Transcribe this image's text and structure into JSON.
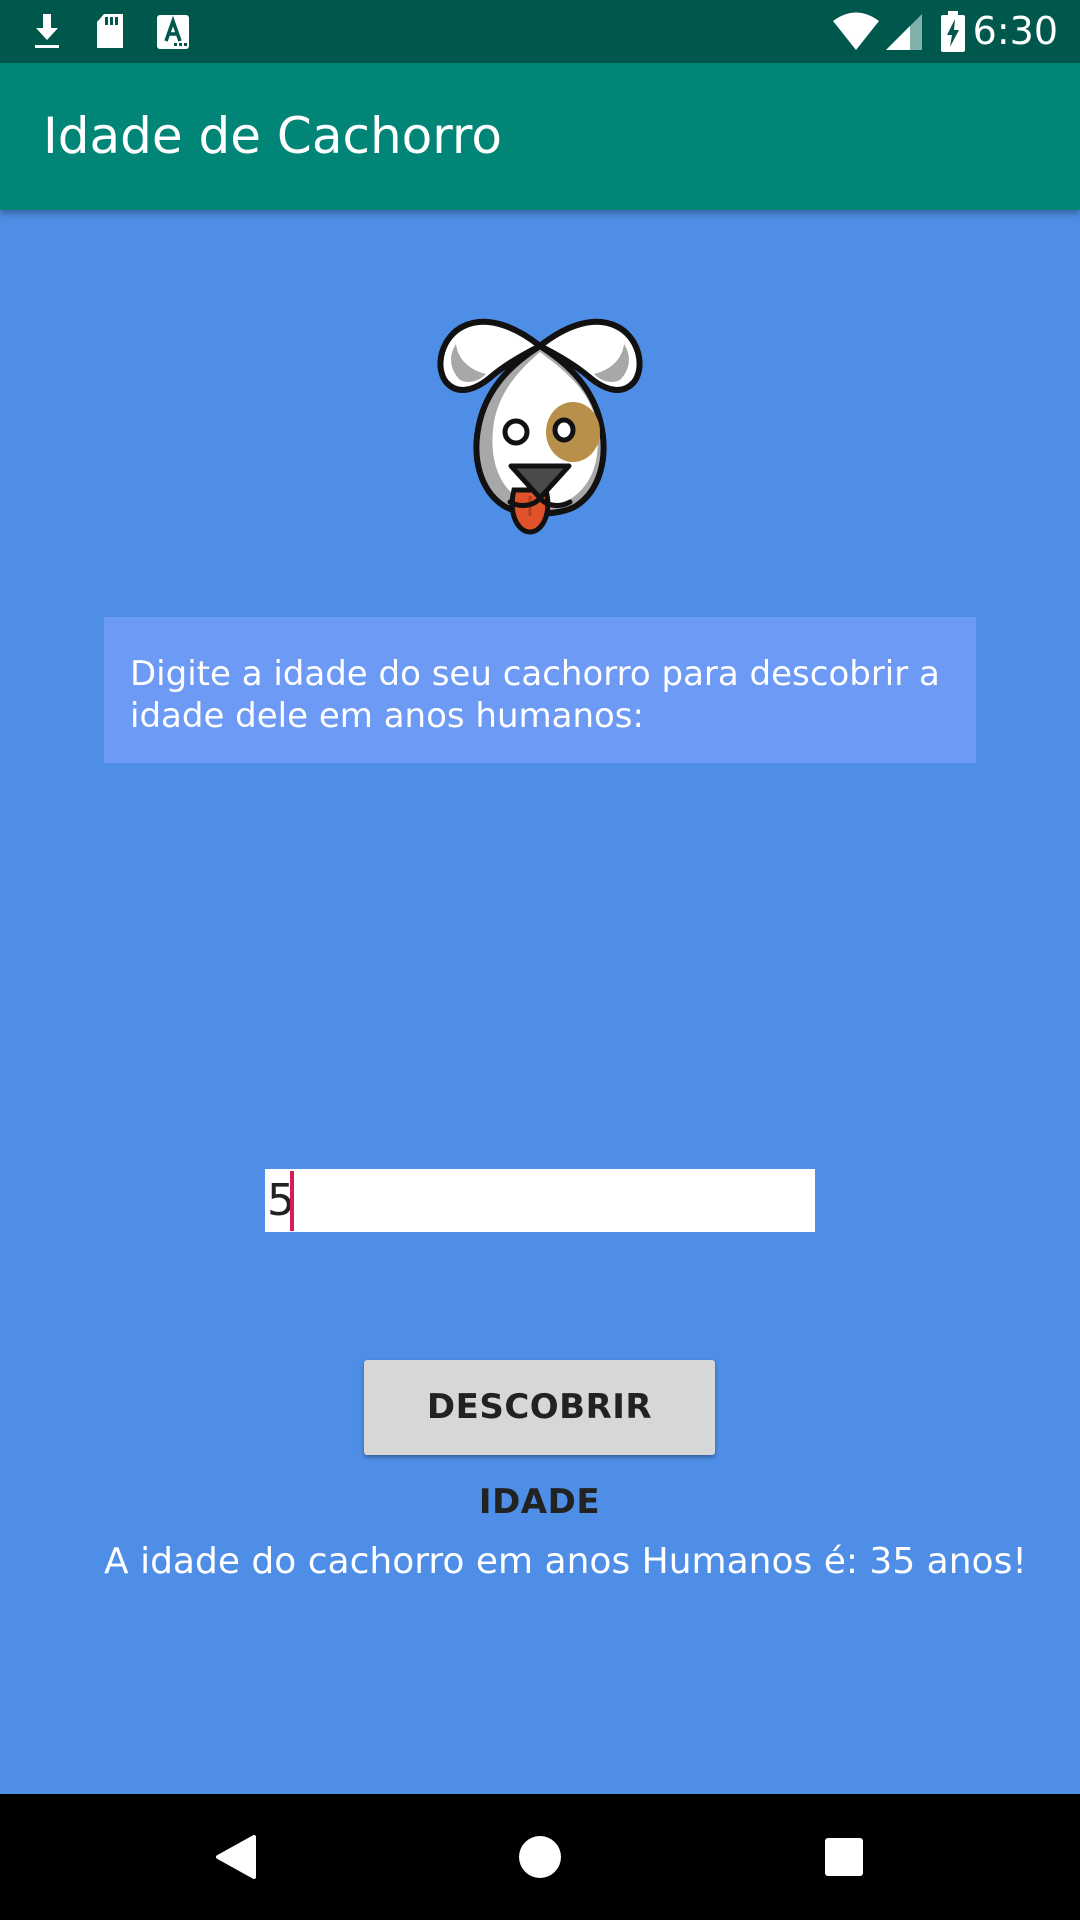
{
  "status_bar": {
    "time": "6:30",
    "icons": [
      "download-icon",
      "sd-card-icon",
      "keyboard-icon",
      "wifi-icon",
      "signal-icon",
      "battery-charging-icon"
    ]
  },
  "app_bar": {
    "title": "Idade de Cachorro"
  },
  "main": {
    "image": "dog-face-icon",
    "instruction": "Digite a idade do seu cachorro para descobrir a idade dele em anos humanos:",
    "age_input": {
      "value": "5"
    },
    "button_label": "DESCOBRIR IDADE",
    "result": "A idade do cachorro em anos Humanos é: 35 anos!"
  },
  "nav_bar": {
    "icons": [
      "back-icon",
      "home-icon",
      "recents-icon"
    ]
  },
  "colors": {
    "status_bar": "#00574b",
    "app_bar": "#008577",
    "background": "#4f8ee6",
    "instruction_box": "#6d9af5",
    "accent": "#d81b60"
  }
}
